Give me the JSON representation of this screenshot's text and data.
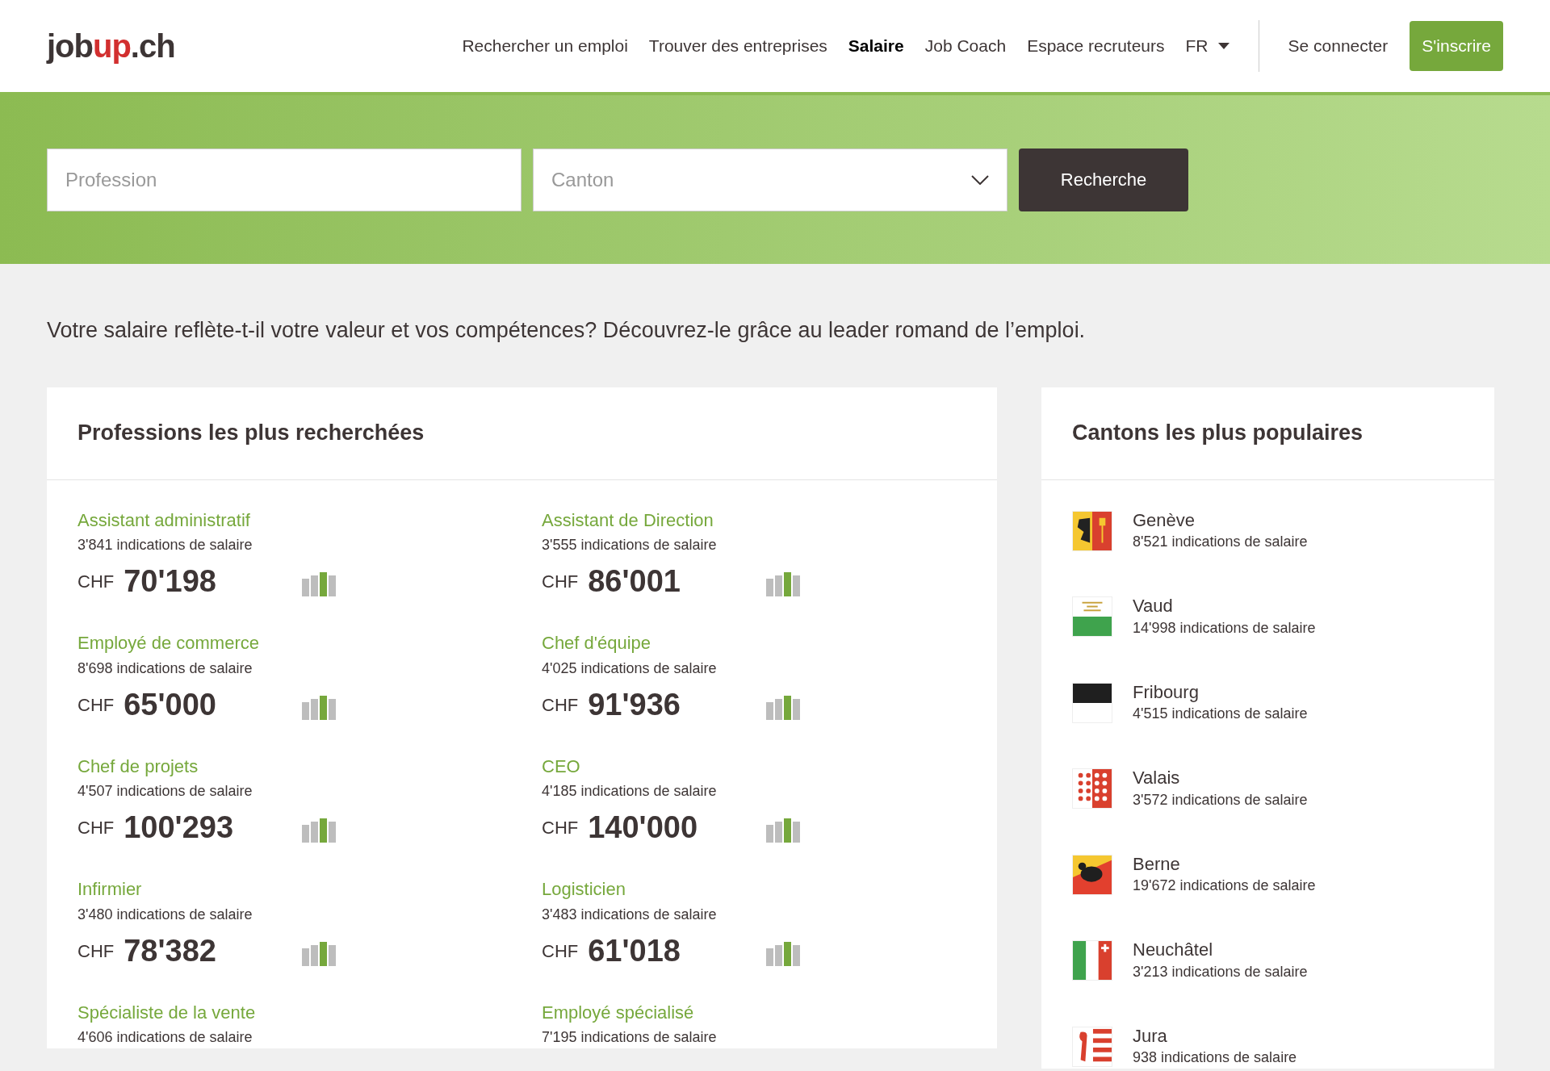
{
  "header": {
    "logo": {
      "part1": "job",
      "part2": "up",
      "part3": ".ch"
    },
    "nav": [
      {
        "label": "Rechercher un emploi",
        "selected": false
      },
      {
        "label": "Trouver des entreprises",
        "selected": false
      },
      {
        "label": "Salaire",
        "selected": true
      },
      {
        "label": "Job Coach",
        "selected": false
      },
      {
        "label": "Espace recruteurs",
        "selected": false
      }
    ],
    "language": "FR",
    "login": "Se connecter",
    "signup": "S'inscrire"
  },
  "search": {
    "profession": {
      "placeholder": "Profession"
    },
    "canton": {
      "placeholder": "Canton"
    },
    "button": "Recherche"
  },
  "intro": "Votre salaire reflète-t-il votre valeur et vos compétences? Découvrez-le grâce au leader romand de l’emploi.",
  "professions": {
    "title": "Professions les plus recherchées",
    "items": [
      {
        "name": "Assistant administratif",
        "count": "3'841 indications de salaire",
        "currency": "CHF",
        "salary": "70'198"
      },
      {
        "name": "Assistant de Direction",
        "count": "3'555 indications de salaire",
        "currency": "CHF",
        "salary": "86'001"
      },
      {
        "name": "Employé de commerce",
        "count": "8'698 indications de salaire",
        "currency": "CHF",
        "salary": "65'000"
      },
      {
        "name": "Chef d'équipe",
        "count": "4'025 indications de salaire",
        "currency": "CHF",
        "salary": "91'936"
      },
      {
        "name": "Chef de projets",
        "count": "4'507 indications de salaire",
        "currency": "CHF",
        "salary": "100'293"
      },
      {
        "name": "CEO",
        "count": "4'185 indications de salaire",
        "currency": "CHF",
        "salary": "140'000"
      },
      {
        "name": "Infirmier",
        "count": "3'480 indications de salaire",
        "currency": "CHF",
        "salary": "78'382"
      },
      {
        "name": "Logisticien",
        "count": "3'483 indications de salaire",
        "currency": "CHF",
        "salary": "61'018"
      },
      {
        "name": "Spécialiste de la vente",
        "count": "4'606 indications de salaire"
      },
      {
        "name": "Employé spécialisé",
        "count": "7'195 indications de salaire"
      }
    ]
  },
  "cantons": {
    "title": "Cantons les plus populaires",
    "items": [
      {
        "kind": "geneve",
        "name": "Genève",
        "count": "8'521 indications de salaire"
      },
      {
        "kind": "vaud",
        "name": "Vaud",
        "count": "14'998 indications de salaire"
      },
      {
        "kind": "fribourg",
        "name": "Fribourg",
        "count": "4'515 indications de salaire"
      },
      {
        "kind": "valais",
        "name": "Valais",
        "count": "3'572 indications de salaire"
      },
      {
        "kind": "berne",
        "name": "Berne",
        "count": "19'672 indications de salaire"
      },
      {
        "kind": "neuchatel",
        "name": "Neuchâtel",
        "count": "3'213 indications de salaire"
      },
      {
        "kind": "jura",
        "name": "Jura",
        "count": "938 indications de salaire"
      }
    ]
  }
}
